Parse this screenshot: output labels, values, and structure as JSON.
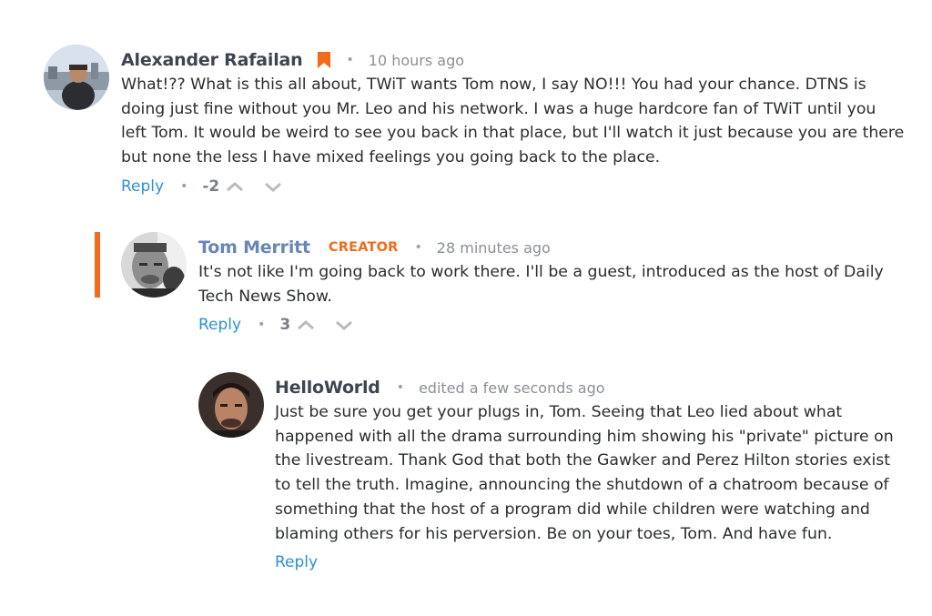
{
  "comments": [
    {
      "author": "Alexander Rafailan",
      "time": "10 hours ago",
      "text_lines": [
        "What!??  What is this all about, TWiT wants Tom now, I say NO!!!  You had your chance. DTNS is",
        "doing just fine without you Mr. Leo and his network.  I was a huge hardcore fan of TWiT until you",
        "left Tom.  It would be weird to see you back in that place, but I'll watch it just because you are there",
        "but none the less I have mixed feelings you going back to the place."
      ],
      "reply_label": "Reply",
      "score": "-2"
    },
    {
      "author": "Tom Merritt",
      "badge": "CREATOR",
      "time": "28 minutes ago",
      "text_lines": [
        "It's not like I'm going back to work there. I'll be a guest, introduced as the host of Daily",
        "Tech News Show."
      ],
      "reply_label": "Reply",
      "score": "3"
    },
    {
      "author": "HelloWorld",
      "time": "edited a few seconds ago",
      "text_lines": [
        "Just be sure you get your plugs in, Tom. Seeing that Leo lied about what",
        "happened with all the drama surrounding him showing his \"private\" picture on",
        "the livestream. Thank God that  both the Gawker and Perez Hilton stories exist",
        "to tell the truth. Imagine, announcing the shutdown of a chatroom because of",
        "something that the host of a program did while children were watching and",
        "blaming others for his perversion. Be on your toes, Tom. And have fun."
      ],
      "reply_label": "Reply"
    }
  ],
  "separator": "•",
  "colors": {
    "accent_orange": "#f26a1b",
    "link_blue": "#2e8fd6",
    "creator_name": "#6a86b5",
    "author_name": "#3f4550",
    "meta_gray": "#8a9097"
  },
  "icons": {
    "bookmark": "bookmark-icon",
    "upvote": "chevron-up-icon",
    "downvote": "chevron-down-icon"
  }
}
